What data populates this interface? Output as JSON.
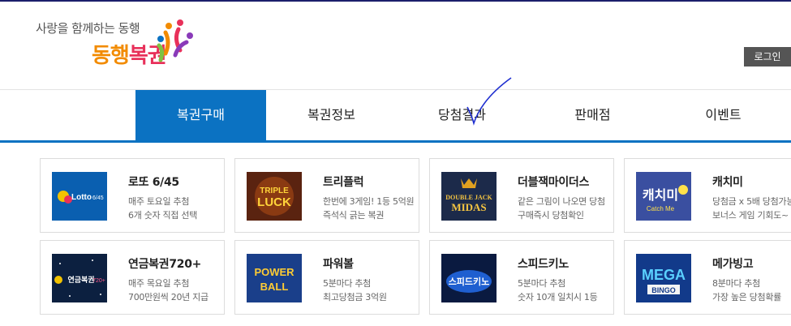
{
  "header": {
    "tagline": "사랑을 함께하는 동행",
    "brand_part1": "동행",
    "brand_part2": "복권",
    "login_label": "로그인"
  },
  "nav": {
    "items": [
      {
        "label": "복권구매",
        "active": true
      },
      {
        "label": "복권정보",
        "active": false
      },
      {
        "label": "당첨결과",
        "active": false
      },
      {
        "label": "판매점",
        "active": false
      },
      {
        "label": "이벤트",
        "active": false
      }
    ]
  },
  "games": [
    {
      "title": "로또 6/45",
      "desc1": "매주 토요일 추첨",
      "desc2": "6개 숫자 직접 선택",
      "thumb_text": "Lotto 6/45"
    },
    {
      "title": "트리플럭",
      "desc1": "한번에 3게임! 1등 5억원",
      "desc2": "즉석식 긁는 복권",
      "thumb_text": "TRIPLE LUCK"
    },
    {
      "title": "더블잭마이더스",
      "desc1": "같은 그림이 나오면 당첨",
      "desc2": "구매즉시 당첨확인",
      "thumb_text": "DOUBLE JACK MIDAS"
    },
    {
      "title": "캐치미",
      "desc1": "당첨금 x 5배 당첨가능",
      "desc2": "보너스 게임 기회도~",
      "thumb_text": "캐치미 Catch Me"
    },
    {
      "title": "연금복권720+",
      "desc1": "매주 목요일 추첨",
      "desc2": "700만원씩 20년 지급",
      "thumb_text": "연금복권720+"
    },
    {
      "title": "파워볼",
      "desc1": "5분마다 추첨",
      "desc2": "최고당첨금 3억원",
      "thumb_text": "POWER BALL"
    },
    {
      "title": "스피드키노",
      "desc1": "5분마다 추첨",
      "desc2": "숫자 10개 일치시 1등",
      "thumb_text": "스피드키노"
    },
    {
      "title": "메가빙고",
      "desc1": "8분마다 추첨",
      "desc2": "가장 높은 당첨확률",
      "thumb_text": "MEGA BINGO"
    }
  ],
  "colors": {
    "nav_active": "#0b72c2",
    "brand_orange": "#f28b00",
    "brand_pink": "#e8305a"
  }
}
